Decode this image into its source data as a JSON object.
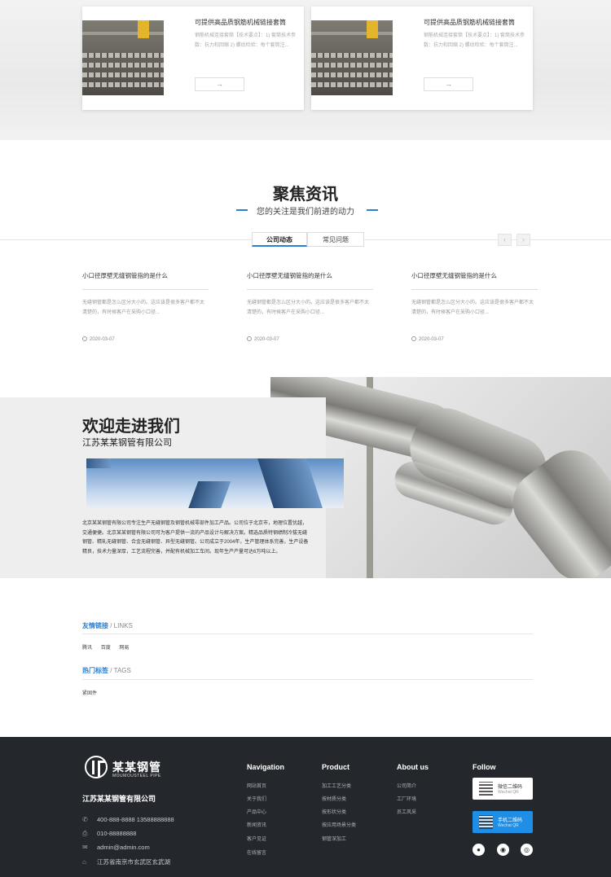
{
  "products": [
    {
      "title": "可提供高品质钢筋机械链接套筒",
      "desc": "钢筋机械连接套筒【技术要点】：1) 套筒技术参数：抗力和回缩 2) 螺纹检验：每个套筒注...",
      "button": "→"
    },
    {
      "title": "可提供高品质钢筋机械链接套筒",
      "desc": "钢筋机械连接套筒【技术要点】：1) 套筒技术参数：抗力和回缩 2) 螺纹检验：每个套筒注...",
      "button": "→"
    }
  ],
  "news": {
    "title": "聚焦资讯",
    "subtitle": "您的关注是我们前进的动力",
    "tabs": [
      "公司动态",
      "常见问题"
    ],
    "prev": "‹",
    "next": "›",
    "items": [
      {
        "title": "小口径厚壁无缝钢管指的是什么",
        "desc": "无缝钢管都是怎么区分大小的。这应该是很多客户都不太清楚的，有时候客户在采购小口径...",
        "date": "2020-03-07"
      },
      {
        "title": "小口径厚壁无缝钢管指的是什么",
        "desc": "无缝钢管都是怎么区分大小的。这应该是很多客户都不太清楚的，有时候客户在采购小口径...",
        "date": "2020-03-07"
      },
      {
        "title": "小口径厚壁无缝钢管指的是什么",
        "desc": "无缝钢管都是怎么区分大小的。这应该是很多客户都不太清楚的，有时候客户在采购小口径...",
        "date": "2020-03-07"
      }
    ]
  },
  "welcome": {
    "heading": "欢迎走进我们",
    "company": "江苏某某钢管有限公司",
    "text": "北京某某钢管有限公司专注生产无缝钢管及钢管机械零部件加工产品。公司位于北京市，地理位置优越，交通便捷。北京某某钢管有限公司可为客户提供一流的产品设计与解决方案。精选品质特钢绩制冷拔无缝钢管、精轧无缝钢管、合金无缝钢管、异型无缝钢管。公司成立于2004年，生产管理体系完善，生产设备精良，技术力量深厚，工艺流程完善，并配有机械加工车间。现年生产产量可达6万吨以上。"
  },
  "links": {
    "title": "友情链接",
    "title_en": "/ LINKS",
    "items": [
      "腾讯",
      "百度",
      "网易"
    ],
    "tags_title": "热门标签",
    "tags_en": "/ TAGS",
    "tags": [
      "紧固件"
    ]
  },
  "footer": {
    "logo_cn": "某某钢管",
    "logo_en": "MOUMOUSTEEL PIPE",
    "company": "江苏某某钢管有限公司",
    "phone": "400-888-8888  13588888888",
    "fax": "010-88888888",
    "email": "admin@admin.com",
    "address": "江苏省南京市玄武区玄武湖",
    "columns": [
      {
        "title": "Navigation",
        "items": [
          "网站首页",
          "关于我们",
          "产品中心",
          "新闻资讯",
          "客户见证",
          "在线留言"
        ]
      },
      {
        "title": "Product",
        "items": [
          "加工工艺分类",
          "按材质分类",
          "按形状分类",
          "按应用场景分类",
          "钢管深加工"
        ]
      },
      {
        "title": "About us",
        "items": [
          "公司简介",
          "工厂环境",
          "员工风采"
        ]
      }
    ],
    "follow": "Follow",
    "wechat_qr": "微信二维码",
    "wechat_qr_en": "Wechat QR",
    "mobile_qr": "手机二维码",
    "mobile_qr_en": "Wechat QR"
  },
  "colors": {
    "accent": "#2d7fd1",
    "footer_bg": "#24272c"
  }
}
